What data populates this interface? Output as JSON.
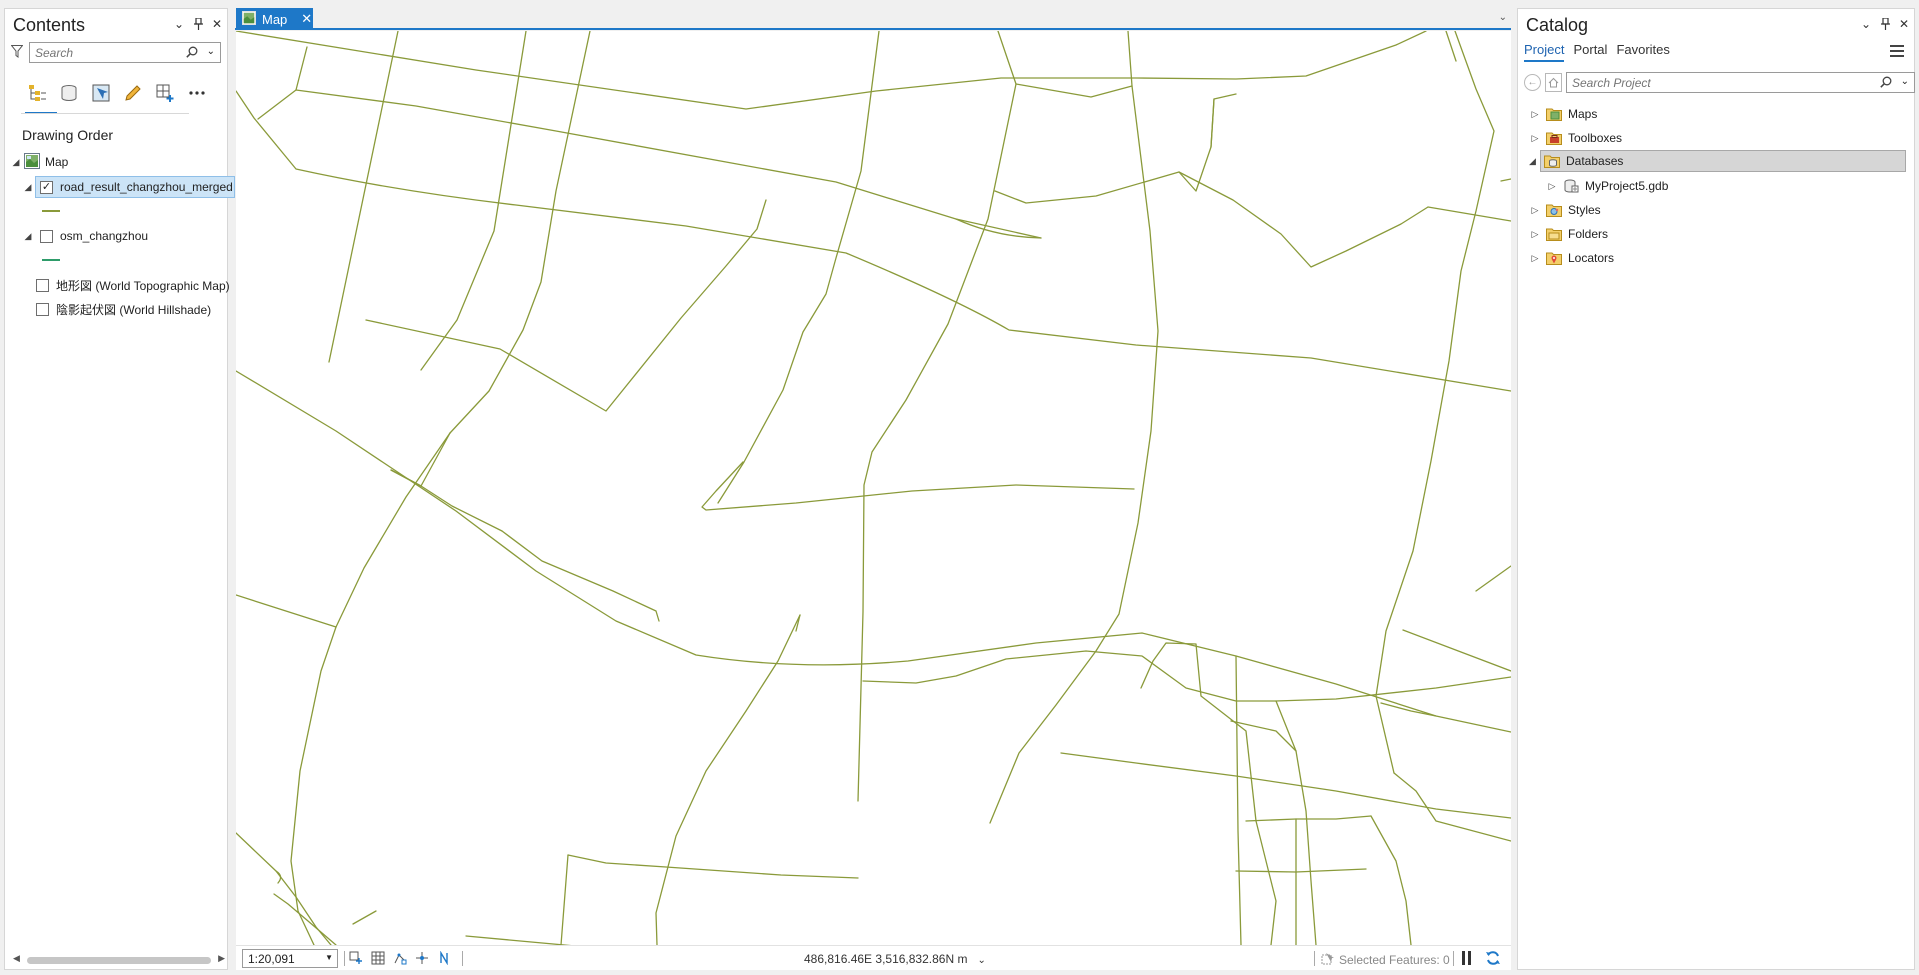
{
  "contents": {
    "title": "Contents",
    "search_placeholder": "Search",
    "drawing_order_label": "Drawing Order",
    "map_label": "Map",
    "layers": [
      {
        "label": "road_result_changzhou_merged",
        "checked": true,
        "color": "#8a9a3a"
      },
      {
        "label": "osm_changzhou",
        "checked": false,
        "color": "#2e9c6a"
      },
      {
        "label": "地形図 (World Topographic Map)",
        "checked": false
      },
      {
        "label": "陰影起伏図 (World Hillshade)",
        "checked": false
      }
    ]
  },
  "map_view": {
    "tab_label": "Map",
    "scale": "1:20,091",
    "coordinates": "486,816.46E 3,516,832.86N m",
    "selected_features": "Selected Features: 0",
    "road_color": "#8a9a3a"
  },
  "catalog": {
    "title": "Catalog",
    "tabs": [
      "Project",
      "Portal",
      "Favorites"
    ],
    "active_tab": "Project",
    "search_placeholder": "Search Project",
    "items": [
      {
        "label": "Maps"
      },
      {
        "label": "Toolboxes"
      },
      {
        "label": "Databases"
      },
      {
        "label": "MyProject5.gdb"
      },
      {
        "label": "Styles"
      },
      {
        "label": "Folders"
      },
      {
        "label": "Locators"
      }
    ]
  },
  "colors": {
    "accent": "#1e78c8",
    "selection": "#cce4f7"
  }
}
